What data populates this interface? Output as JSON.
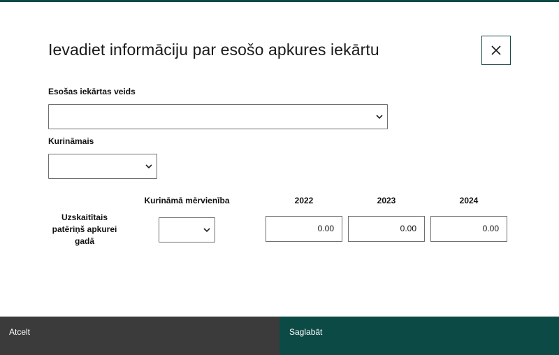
{
  "dialog": {
    "title": "Ievadiet informāciju par esošo apkures iekārtu",
    "close_icon": "close-icon"
  },
  "form": {
    "device_type": {
      "label": "Esošas iekārtas veids",
      "value": ""
    },
    "fuel": {
      "label": "Kurināmais",
      "value": ""
    },
    "consumption": {
      "row_label": "Uzskaitītais patēriņš apkurei gadā",
      "unit_header": "Kurināmā mērvienība",
      "unit_value": "",
      "years": [
        {
          "year": "2022",
          "value": "0.00"
        },
        {
          "year": "2023",
          "value": "0.00"
        },
        {
          "year": "2024",
          "value": "0.00"
        }
      ]
    }
  },
  "footer": {
    "cancel_label": "Atcelt",
    "save_label": "Saglabāt"
  },
  "colors": {
    "accent": "#0c4a45",
    "cancel_bg": "#3b3b3b"
  }
}
